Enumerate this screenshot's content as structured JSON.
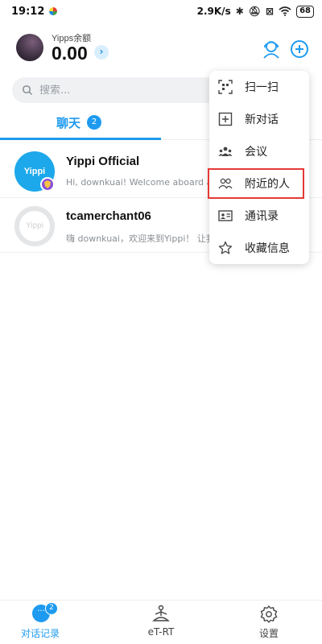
{
  "status_bar": {
    "time": "19:12",
    "speed": "2.9K/s",
    "battery": "68"
  },
  "header": {
    "balance_label": "Yipps余额",
    "balance_value": "0.00",
    "chevron": "›"
  },
  "search": {
    "placeholder": "搜索..."
  },
  "tabs": {
    "chat_label": "聊天",
    "chat_badge": "2"
  },
  "chats": [
    {
      "avatar_text": "Yippi",
      "name": "Yippi Official",
      "preview": "Hi, downkuai! Welcome aboard as ou"
    },
    {
      "avatar_text": "Yippi",
      "name": "tcamerchant06",
      "preview": "嗨 downkuai，欢迎来到Yippi！ 让我们一"
    }
  ],
  "menu": {
    "items": [
      {
        "label": "扫一扫",
        "icon": "scan-icon"
      },
      {
        "label": "新对话",
        "icon": "new-chat-icon"
      },
      {
        "label": "会议",
        "icon": "meeting-icon"
      },
      {
        "label": "附近的人",
        "icon": "people-nearby-icon"
      },
      {
        "label": "通讯录",
        "icon": "contacts-icon"
      },
      {
        "label": "收藏信息",
        "icon": "star-icon"
      }
    ],
    "highlight_color": "#e53935"
  },
  "bottom_nav": {
    "items": [
      {
        "label": "对话记录",
        "badge": "2",
        "bubble": "···"
      },
      {
        "label": "eT-RT"
      },
      {
        "label": "设置"
      }
    ]
  },
  "colors": {
    "accent": "#1e9bf0"
  }
}
